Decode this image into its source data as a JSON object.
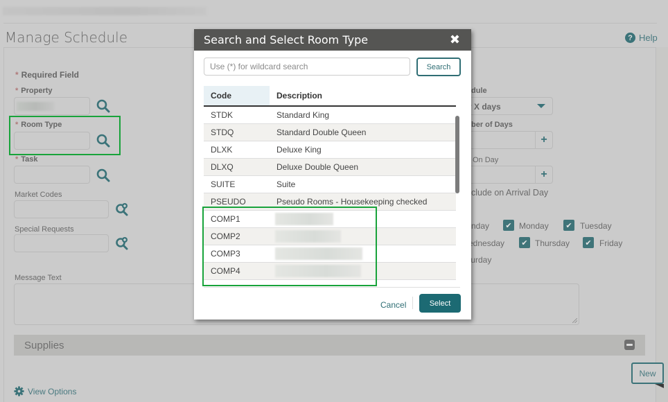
{
  "page": {
    "title": "Manage Schedule",
    "help_label": "Help",
    "required_note": "Required Field",
    "required_marker": "*"
  },
  "form": {
    "property": {
      "label": "Property",
      "value": ""
    },
    "room_type": {
      "label": "Room Type",
      "value": ""
    },
    "task": {
      "label": "Task",
      "value": ""
    },
    "market_codes": {
      "label": "Market Codes",
      "value": ""
    },
    "special_requests": {
      "label": "Special Requests",
      "value": ""
    },
    "message_text": {
      "label": "Message Text",
      "value": ""
    },
    "schedule": {
      "label_partial": "dule",
      "value_partial": "y X days"
    },
    "number_of_days": {
      "label_partial": "ber of Days",
      "value": ""
    },
    "on_day": {
      "label_partial": "On Day",
      "value": ""
    },
    "include_arrival": {
      "label_partial": "clude on Arrival Day"
    },
    "days": [
      {
        "label": "nday",
        "checked": null
      },
      {
        "label": "Monday",
        "checked": true
      },
      {
        "label": "Tuesday",
        "checked": true
      },
      {
        "label": "ednesday",
        "checked": null
      },
      {
        "label": "Thursday",
        "checked": true
      },
      {
        "label": "Friday",
        "checked": true
      },
      {
        "label": "turday",
        "checked": null
      }
    ]
  },
  "supplies": {
    "title": "Supplies"
  },
  "footer": {
    "view_options": "View Options",
    "new_button": "New"
  },
  "icons": {
    "search": "magnifier",
    "search_plus": "magnifier-plus",
    "help": "?",
    "close": "✖",
    "check": "✔",
    "plus": "+",
    "gear": "⚙",
    "collapse": "minus"
  },
  "colors": {
    "accent": "#2f6e74",
    "select_button": "#1c6a73",
    "highlight_box": "#18a33a",
    "modal_header": "#555553"
  },
  "modal": {
    "title": "Search and Select Room Type",
    "search_placeholder": "Use (*) for wildcard search",
    "search_value": "",
    "search_button": "Search",
    "columns": {
      "code": "Code",
      "description": "Description"
    },
    "rows": [
      {
        "code": "STDK",
        "description": "Standard King"
      },
      {
        "code": "STDQ",
        "description": "Standard Double Queen"
      },
      {
        "code": "DLXK",
        "description": "Deluxe King"
      },
      {
        "code": "DLXQ",
        "description": "Deluxe Double Queen"
      },
      {
        "code": "SUITE",
        "description": "Suite"
      },
      {
        "code": "PSEUDO",
        "description": "Pseudo Rooms - Housekeeping checked"
      },
      {
        "code": "COMP1",
        "description": ""
      },
      {
        "code": "COMP2",
        "description": ""
      },
      {
        "code": "COMP3",
        "description": ""
      },
      {
        "code": "COMP4",
        "description": ""
      }
    ],
    "cancel_label": "Cancel",
    "select_label": "Select"
  }
}
